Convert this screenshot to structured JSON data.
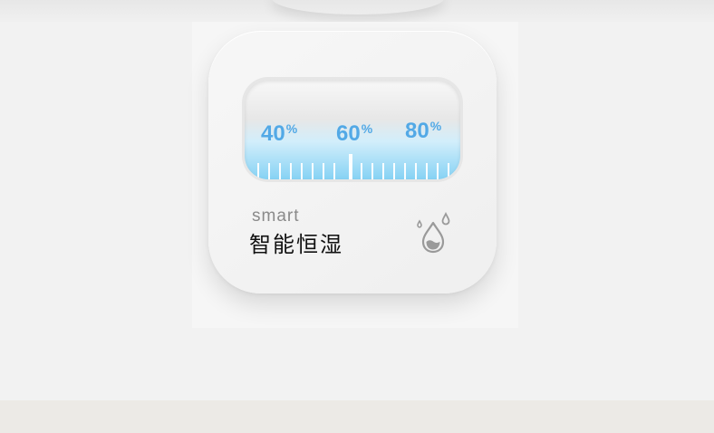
{
  "card": {
    "gauge": {
      "labels": [
        {
          "number": "40",
          "unit": "%"
        },
        {
          "number": "60",
          "unit": "%"
        },
        {
          "number": "80",
          "unit": "%"
        }
      ],
      "value_percent": 60,
      "accent_color": "#52a9e6"
    },
    "subtitle": "smart",
    "title": "智能恒湿",
    "icon": "water-drop-icon"
  }
}
